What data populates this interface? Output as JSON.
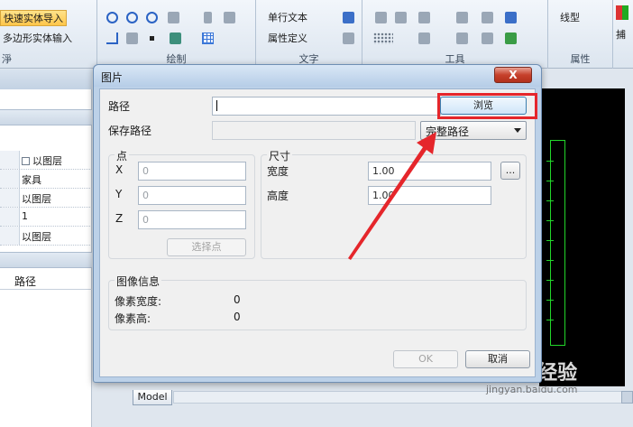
{
  "ribbon": {
    "fast_import": "快速实体导入",
    "polygon_input": "多边形实体输入",
    "left_group_label_fragment": "淨",
    "draw_group_label": "绘制",
    "single_text": "单行文本",
    "attr_define": "属性定义",
    "text_group_label": "文字",
    "tools_group_label": "工具",
    "linetype": "线型",
    "property_group_label": "属性",
    "capture_fragment": "捕"
  },
  "left_panel": {
    "rows": [
      {
        "value": "以图层",
        "checkbox": true
      },
      {
        "value": "家具",
        "checkbox": false
      },
      {
        "value": "以图层",
        "checkbox": false
      },
      {
        "value": "1",
        "checkbox": false
      },
      {
        "value": "以图层",
        "checkbox": false
      }
    ],
    "path_header": "路径"
  },
  "dialog": {
    "title": "图片",
    "close_label": "X",
    "path_label": "路径",
    "path_value": "",
    "browse_label": "浏览",
    "save_path_label": "保存路径",
    "save_path_value": "",
    "path_mode_selected": "完整路径",
    "point_group": "点",
    "x_label": "X",
    "x_value": "0",
    "y_label": "Y",
    "y_value": "0",
    "z_label": "Z",
    "z_value": "0",
    "pick_point_label": "选择点",
    "size_group": "尺寸",
    "width_label": "宽度",
    "width_value": "1.00",
    "ellipsis_label": "...",
    "height_label": "高度",
    "height_value": "1.00",
    "image_info_group": "图像信息",
    "pixel_width_label": "像素宽度:",
    "pixel_width_value": "0",
    "pixel_height_label": "像素高:",
    "pixel_height_value": "0",
    "ok_label": "OK",
    "cancel_label": "取消"
  },
  "status": {
    "model_tab": "Model"
  },
  "watermark": {
    "main": "Baidu经验",
    "sub": "jingyan.baidu.com"
  },
  "colors": {
    "highlight_red": "#e5262b",
    "canvas_black": "#000000",
    "cad_green": "#22d62a"
  }
}
